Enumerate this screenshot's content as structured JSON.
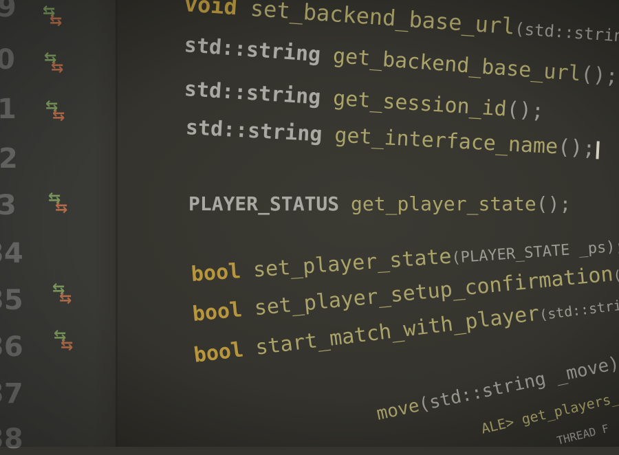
{
  "gutter": {
    "line_numbers": [
      "9",
      "0",
      "1",
      "2",
      "3",
      "34",
      "35",
      "36",
      "37",
      "38"
    ],
    "change_marker_icon": "arrows-exchange-icon"
  },
  "code": {
    "l1": {
      "kw": "void",
      "fn": "set_backend_base_url",
      "params": "(std::string _url);"
    },
    "l2": {
      "ty": "std::string",
      "fn": "get_backend_base_url",
      "params": "();"
    },
    "l3": {
      "ty": "std::string",
      "fn": "get_session_id",
      "params": "();"
    },
    "l4": {
      "ty": "std::string",
      "fn": "get_interface_name",
      "params": "();"
    },
    "l5": {
      "ty": "PLAYER_STATUS",
      "fn": "get_player_state",
      "params": "();"
    },
    "l6": {
      "kw": "bool",
      "fn": "set_player_state",
      "params": "(PLAYER_STATE _ps);"
    },
    "l7": {
      "kw": "bool",
      "fn": "set_player_setup_confirmation",
      "params": "(PLAYER_SE"
    },
    "l8": {
      "kw": "bool",
      "fn": "start_match_with_player",
      "params": "(std::string _v"
    },
    "l9": {
      "fn": "move",
      "params": "(std::string _move);"
    },
    "l10": {
      "text": "ALE> get_players_avai"
    },
    "l11": {
      "text": "THREAD F"
    }
  },
  "colors": {
    "background": "#34332e",
    "type": "#a9a8a3",
    "keyword": "#b8963e",
    "function": "#aaa36a",
    "marker_green": "#7d9b5e",
    "marker_orange": "#b56d4a"
  }
}
